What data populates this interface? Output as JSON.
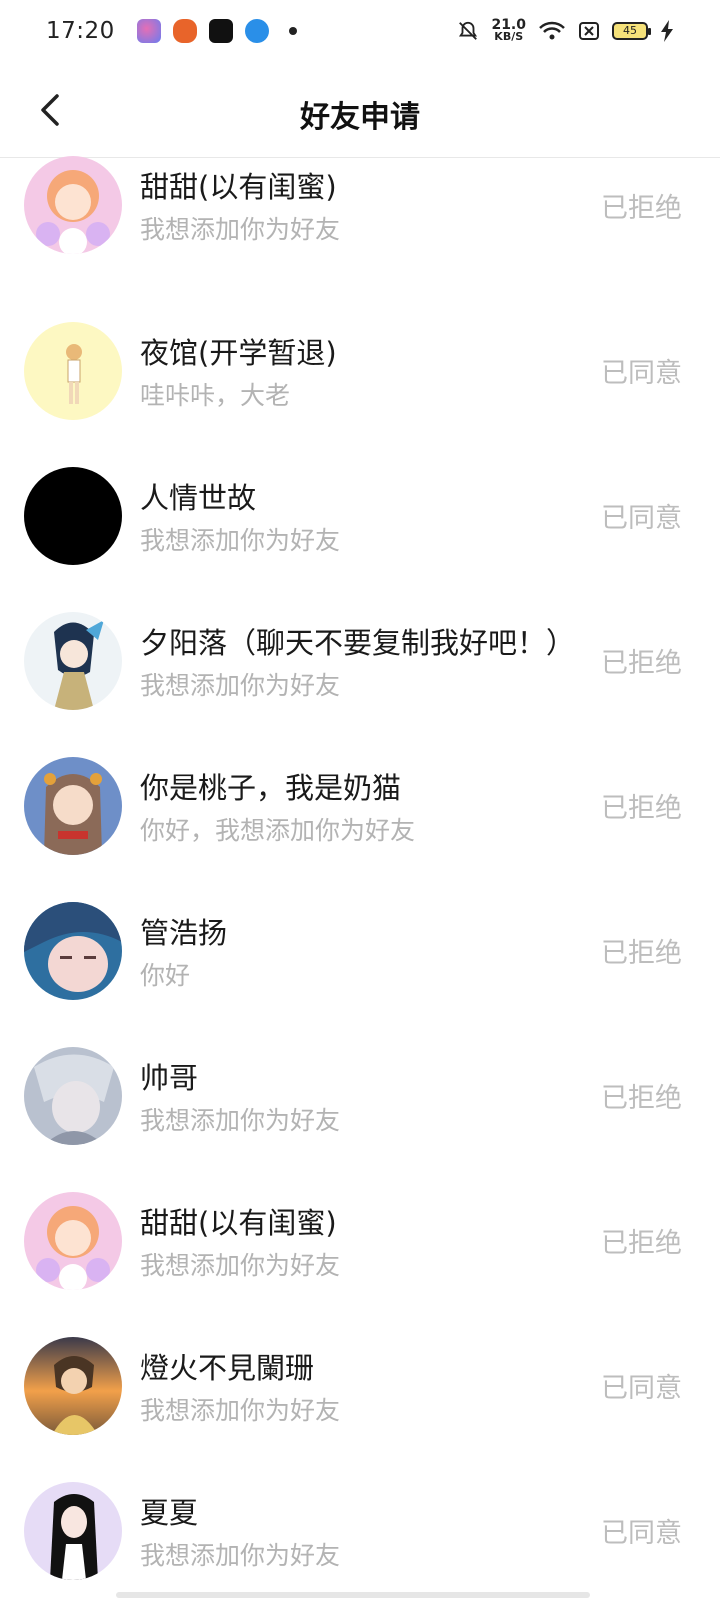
{
  "status_bar": {
    "time": "17:20",
    "net_speed_value": "21.0",
    "net_speed_unit": "KB/S",
    "battery": "45"
  },
  "header": {
    "title": "好友申请"
  },
  "requests": [
    {
      "name": "甜甜(以有闺蜜)",
      "message": "我想添加你为好友",
      "status": "已拒绝"
    },
    {
      "name": "夜馆(开学暂退)",
      "message": "哇咔咔，大老",
      "status": "已同意"
    },
    {
      "name": "人情世故",
      "message": "我想添加你为好友",
      "status": "已同意"
    },
    {
      "name": "夕阳落（聊天不要复制我好吧！）",
      "message": "我想添加你为好友",
      "status": "已拒绝"
    },
    {
      "name": "你是桃子，我是奶猫",
      "message": "你好，我想添加你为好友",
      "status": "已拒绝"
    },
    {
      "name": "管浩扬",
      "message": "你好",
      "status": "已拒绝"
    },
    {
      "name": "帅哥",
      "message": "我想添加你为好友",
      "status": "已拒绝"
    },
    {
      "name": "甜甜(以有闺蜜)",
      "message": "我想添加你为好友",
      "status": "已拒绝"
    },
    {
      "name": "燈火不見闌珊",
      "message": "我想添加你为好友",
      "status": "已同意"
    },
    {
      "name": "夏夏",
      "message": "我想添加你为好友",
      "status": "已同意"
    }
  ],
  "colors": {
    "name_text": "#1a1a1a",
    "secondary_text": "#b3b3b3",
    "status_text": "#bdbdbd",
    "divider": "#e8e8e8"
  }
}
